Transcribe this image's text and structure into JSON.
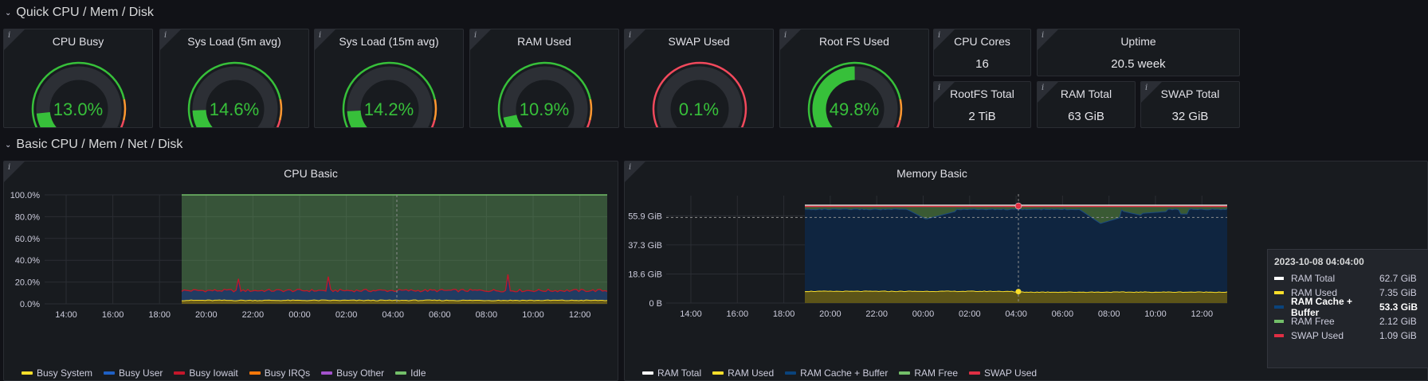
{
  "rows": [
    {
      "title": "Quick CPU / Mem / Disk"
    },
    {
      "title": "Basic CPU / Mem / Net / Disk"
    }
  ],
  "gauges": [
    {
      "title": "CPU Busy",
      "value_text": "13.0%",
      "value": 13.0,
      "threshold": "green-orange-red"
    },
    {
      "title": "Sys Load (5m avg)",
      "value_text": "14.6%",
      "value": 14.6,
      "threshold": "green-orange-red"
    },
    {
      "title": "Sys Load (15m avg)",
      "value_text": "14.2%",
      "value": 14.2,
      "threshold": "green-orange-red"
    },
    {
      "title": "RAM Used",
      "value_text": "10.9%",
      "value": 10.9,
      "threshold": "green-orange-red"
    },
    {
      "title": "SWAP Used",
      "value_text": "0.1%",
      "value": 0.1,
      "threshold": "orange-red"
    },
    {
      "title": "Root FS Used",
      "value_text": "49.8%",
      "value": 49.8,
      "threshold": "green-orange-red"
    }
  ],
  "stats": {
    "cpu_cores": {
      "title": "CPU Cores",
      "value": "16"
    },
    "uptime": {
      "title": "Uptime",
      "value": "20.5 week"
    },
    "rootfs_total": {
      "title": "RootFS Total",
      "value": "2 TiB"
    },
    "ram_total": {
      "title": "RAM Total",
      "value": "63 GiB"
    },
    "swap_total": {
      "title": "SWAP Total",
      "value": "32 GiB"
    }
  },
  "colors": {
    "green": "#37c03a",
    "orange": "#ff9830",
    "red": "#f2495c",
    "track": "#2c2f35",
    "busy_system": "#fade2a",
    "busy_user": "#1f60c4",
    "busy_iowait": "#c4162a",
    "busy_irqs": "#ff780a",
    "busy_other": "#a352cc",
    "idle": "#73bf69",
    "ram_total": "#ffffff",
    "ram_used": "#fade2a",
    "ram_cache": "#0a437c",
    "ram_free": "#73bf69",
    "swap_used": "#e02f44"
  },
  "cpu_panel": {
    "title": "CPU Basic",
    "legend": [
      "Busy System",
      "Busy User",
      "Busy Iowait",
      "Busy IRQs",
      "Busy Other",
      "Idle"
    ]
  },
  "mem_panel": {
    "title": "Memory Basic",
    "legend": [
      "RAM Total",
      "RAM Used",
      "RAM Cache + Buffer",
      "RAM Free",
      "SWAP Used"
    ]
  },
  "tooltip": {
    "time": "2023-10-08 04:04:00",
    "rows": [
      {
        "label": "RAM Total",
        "value": "62.7 GiB",
        "color": "#ffffff"
      },
      {
        "label": "RAM Used",
        "value": "7.35 GiB",
        "color": "#fade2a"
      },
      {
        "label": "RAM Cache + Buffer",
        "value": "53.3 GiB",
        "color": "#0a437c",
        "highlight": true
      },
      {
        "label": "RAM Free",
        "value": "2.12 GiB",
        "color": "#73bf69"
      },
      {
        "label": "SWAP Used",
        "value": "1.09 GiB",
        "color": "#e02f44"
      }
    ]
  },
  "chart_data": [
    {
      "type": "area",
      "title": "CPU Basic",
      "x": [
        "14:00",
        "16:00",
        "18:00",
        "20:00",
        "22:00",
        "00:00",
        "02:00",
        "04:00",
        "06:00",
        "08:00",
        "10:00",
        "12:00"
      ],
      "y_ticks": [
        "0.0%",
        "20.0%",
        "40.0%",
        "60.0%",
        "80.0%",
        "100.0%"
      ],
      "ylim": [
        0,
        100
      ],
      "data_start": "18:55",
      "series": [
        {
          "name": "Busy System",
          "values": [
            3,
            3,
            3,
            3,
            3,
            3,
            3,
            3,
            3,
            3
          ]
        },
        {
          "name": "Busy User",
          "values": [
            9,
            9,
            9,
            9,
            9,
            9,
            9,
            9,
            9,
            9
          ]
        },
        {
          "name": "Busy Iowait",
          "values": [
            0.5,
            0.5,
            0.5,
            0.5,
            0.5,
            0.5,
            0.5,
            0.5,
            0.5,
            0.5
          ]
        },
        {
          "name": "Busy IRQs",
          "values": [
            0.2,
            0.2,
            0.2,
            0.2,
            0.2,
            0.2,
            0.2,
            0.2,
            0.2,
            0.2
          ]
        },
        {
          "name": "Busy Other",
          "values": [
            0.1,
            0.1,
            0.1,
            0.1,
            0.1,
            0.1,
            0.1,
            0.1,
            0.1,
            0.1
          ]
        },
        {
          "name": "Idle",
          "values": [
            87,
            87,
            87,
            87,
            87,
            87,
            87,
            87,
            87,
            87
          ]
        }
      ]
    },
    {
      "type": "area",
      "title": "Memory Basic",
      "x": [
        "14:00",
        "16:00",
        "18:00",
        "20:00",
        "22:00",
        "00:00",
        "02:00",
        "04:00",
        "06:00",
        "08:00",
        "10:00",
        "12:00"
      ],
      "y_ticks": [
        "0 B",
        "18.6 GiB",
        "37.3 GiB",
        "55.9 GiB"
      ],
      "ylim": [
        0,
        62.7
      ],
      "data_start": "18:55",
      "series": [
        {
          "name": "RAM Total",
          "values": [
            62.7,
            62.7,
            62.7,
            62.7,
            62.7,
            62.7,
            62.7,
            62.7
          ]
        },
        {
          "name": "RAM Used",
          "values": [
            7.4,
            7.4,
            7.3,
            7.4,
            7.35,
            7.4,
            7.5,
            7.4
          ]
        },
        {
          "name": "RAM Cache + Buffer",
          "values": [
            53,
            52,
            49,
            52,
            53.3,
            51,
            47,
            50
          ]
        },
        {
          "name": "RAM Free",
          "values": [
            2.3,
            3.3,
            6.4,
            3.3,
            2.12,
            4.3,
            8.2,
            5.3
          ]
        },
        {
          "name": "SWAP Used",
          "values": [
            1.09,
            1.09,
            1.09,
            1.09,
            1.09,
            1.09,
            1.09,
            1.09
          ]
        }
      ]
    }
  ]
}
